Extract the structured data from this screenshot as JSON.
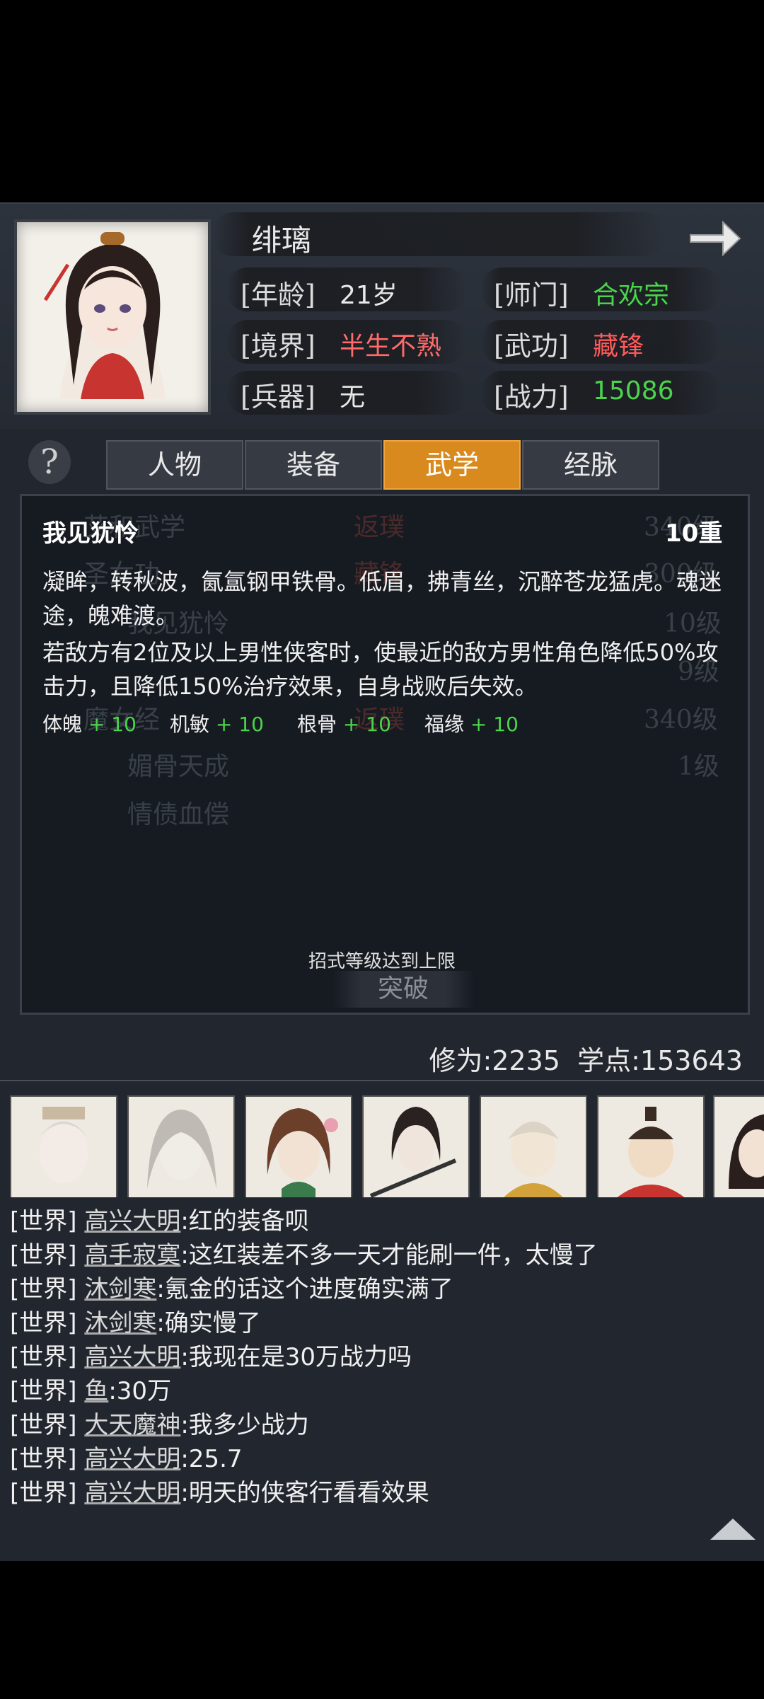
{
  "character": {
    "name": "绯璃",
    "age_label": "[年龄]",
    "age": "21岁",
    "sect_label": "[师门]",
    "sect": "合欢宗",
    "realm_label": "[境界]",
    "realm": "半生不熟",
    "skill_label": "[武功]",
    "skill": "藏锋",
    "weapon_label": "[兵器]",
    "weapon": "无",
    "power_label": "[战力]",
    "power": "15086"
  },
  "tabs": [
    "人物",
    "装备",
    "武学",
    "经脉"
  ],
  "active_tab": "武学",
  "help_icon": "?",
  "background_list": [
    {
      "name": "艾和武学",
      "tag": "返璞",
      "level": "340级"
    },
    {
      "name": "圣女功",
      "tag": "藏锋",
      "level": "300级"
    },
    {
      "name": "我见犹怜",
      "tag": "",
      "level": "10级"
    },
    {
      "name": "",
      "tag": "",
      "level": "9级"
    },
    {
      "name": "魔女经",
      "tag": "返璞",
      "level": "340级"
    },
    {
      "name": "媚骨天成",
      "tag": "",
      "level": "1级"
    },
    {
      "name": "情债血偿",
      "tag": "",
      "level": ""
    }
  ],
  "skill_detail": {
    "title": "我见犹怜",
    "level": "10重",
    "desc1": "凝眸，转秋波，氤氲钢甲铁骨。低眉，拂青丝，沉醉苍龙猛虎。魂迷途，魄难渡。",
    "desc2": "若敌方有2位及以上男性侠客时，使最近的敌方男性角色降低50%攻击力，且降低150%治疗效果，自身战败后失效。",
    "stats": [
      {
        "name": "体魄",
        "plus": "+ 10"
      },
      {
        "name": "机敏",
        "plus": "+ 10"
      },
      {
        "name": "根骨",
        "plus": "+ 10"
      },
      {
        "name": "福缘",
        "plus": "+ 10"
      }
    ]
  },
  "limit_text": "招式等级达到上限",
  "break_label": "突破",
  "cultivation": "修为:2235",
  "study_points": "学点:153643",
  "chat": [
    {
      "channel": "[世界]",
      "name": "高兴大明",
      "msg": ":红的装备呗"
    },
    {
      "channel": "[世界]",
      "name": "高手寂寞",
      "msg": ":这红装差不多一天才能刷一件，太慢了"
    },
    {
      "channel": "[世界]",
      "name": "沐剑寒",
      "msg": ":氪金的话这个进度确实满了"
    },
    {
      "channel": "[世界]",
      "name": "沐剑寒",
      "msg": ":确实慢了"
    },
    {
      "channel": "[世界]",
      "name": "高兴大明",
      "msg": ":我现在是30万战力吗"
    },
    {
      "channel": "[世界]",
      "name": "鱼",
      "msg": ":30万"
    },
    {
      "channel": "[世界]",
      "name": "大天魔神",
      "msg": ":我多少战力"
    },
    {
      "channel": "[世界]",
      "name": "高兴大明",
      "msg": ":25.7"
    },
    {
      "channel": "[世界]",
      "name": "高兴大明",
      "msg": ":明天的侠客行看看效果"
    }
  ],
  "colors": {
    "green": "#4bd44b",
    "red": "#ff5a5a",
    "orange": "#d98a1e"
  }
}
